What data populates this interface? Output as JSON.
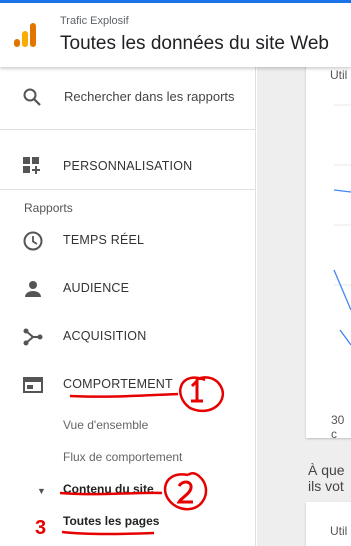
{
  "header": {
    "account": "Trafic Explosif",
    "property": "Toutes les données du site Web"
  },
  "sidebar": {
    "search": {
      "placeholder": "Rechercher dans les rapports"
    },
    "personnalisation": "PERSONNALISATION",
    "section_label": "Rapports",
    "items": [
      {
        "label": "TEMPS RÉEL",
        "icon": "clock-icon"
      },
      {
        "label": "AUDIENCE",
        "icon": "person-icon"
      },
      {
        "label": "ACQUISITION",
        "icon": "acquisition-icon"
      },
      {
        "label": "COMPORTEMENT",
        "icon": "behavior-icon"
      }
    ],
    "sub_items": [
      {
        "label": "Vue d'ensemble"
      },
      {
        "label": "Flux de comportement"
      },
      {
        "label": "Contenu du site"
      },
      {
        "label": "Toutes les pages"
      }
    ]
  },
  "content": {
    "card1_label": "Util",
    "x_label": "30 c",
    "question_line1": "À que",
    "question_line2": "ils vot",
    "card2_label": "Util"
  },
  "annotations": {
    "number_3": "3"
  },
  "colors": {
    "accent_blue": "#1a73e8",
    "annotation_red": "#e60000",
    "logo_orange": "#f9ab00",
    "logo_dark": "#e37400"
  }
}
